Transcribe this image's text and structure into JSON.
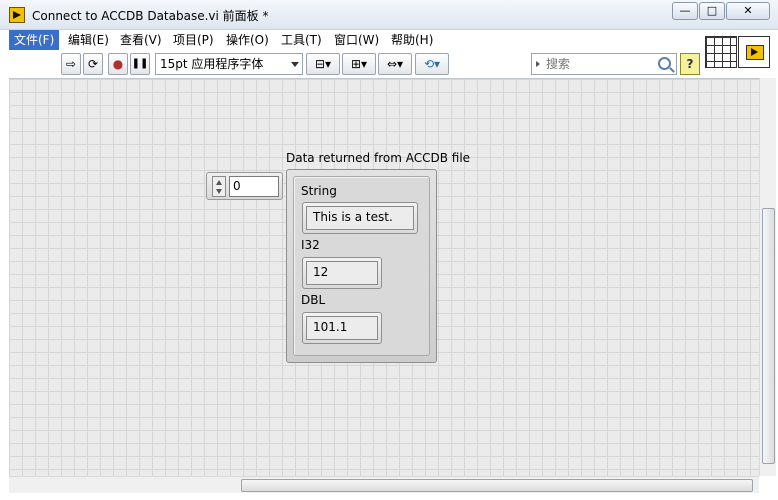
{
  "window": {
    "title": "Connect to ACCDB Database.vi 前面板 *",
    "minimize": "—",
    "maximize": "□",
    "close": "✕"
  },
  "menubar": {
    "items": [
      {
        "label": "文件(F)"
      },
      {
        "label": "编辑(E)"
      },
      {
        "label": "查看(V)"
      },
      {
        "label": "项目(P)"
      },
      {
        "label": "操作(O)"
      },
      {
        "label": "工具(T)"
      },
      {
        "label": "窗口(W)"
      },
      {
        "label": "帮助(H)"
      }
    ]
  },
  "toolbar": {
    "run": "⇨",
    "run_continuous": "⟳",
    "abort": "●",
    "pause": "❚❚",
    "font": "15pt 应用程序字体",
    "align": "⊟▾",
    "distribute": "⊞▾",
    "resize": "⇔▾",
    "reorder": "⟲▾",
    "search_placeholder": "搜索",
    "help": "?"
  },
  "front_panel": {
    "numeric_control": {
      "value": "0"
    },
    "cluster": {
      "label": "Data returned from ACCDB file",
      "elements": [
        {
          "label": "String",
          "value": "This is a test."
        },
        {
          "label": "I32",
          "value": "12"
        },
        {
          "label": "DBL",
          "value": "101.1"
        }
      ]
    }
  },
  "colors": {
    "menu_active": "#3a6fc9",
    "canvas": "#ebebeb"
  }
}
